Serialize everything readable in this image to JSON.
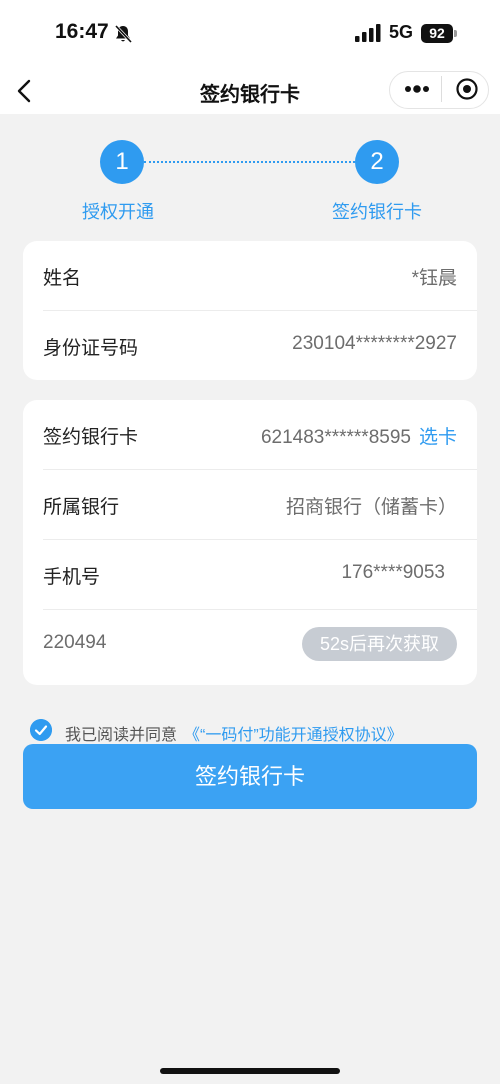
{
  "status_bar": {
    "time": "16:47",
    "network": "5G",
    "battery": "92"
  },
  "nav": {
    "title": "签约银行卡"
  },
  "steps": [
    {
      "number": "1",
      "label": "授权开通"
    },
    {
      "number": "2",
      "label": "签约银行卡"
    }
  ],
  "identity": {
    "rows": [
      {
        "label": "姓名",
        "value": "*钰晨"
      },
      {
        "label": "身份证号码",
        "value": "230104********2927"
      }
    ]
  },
  "bank": {
    "card_label": "签约银行卡",
    "card_value": "621483******8595",
    "pick_card": "选卡",
    "bank_label": "所属银行",
    "bank_value": "招商银行（储蓄卡）",
    "phone_label": "手机号",
    "phone_value": "176****9053",
    "code_value": "220494",
    "resend_label": "52s后再次获取"
  },
  "agreement": {
    "prefix": "我已阅读并同意",
    "link": "《“一码付”功能开通授权协议》"
  },
  "submit_label": "签约银行卡",
  "colors": {
    "accent": "#2f9bf0",
    "button": "#3ba2f3",
    "disabled": "#c7ccd3",
    "background": "#f2f2f2"
  }
}
